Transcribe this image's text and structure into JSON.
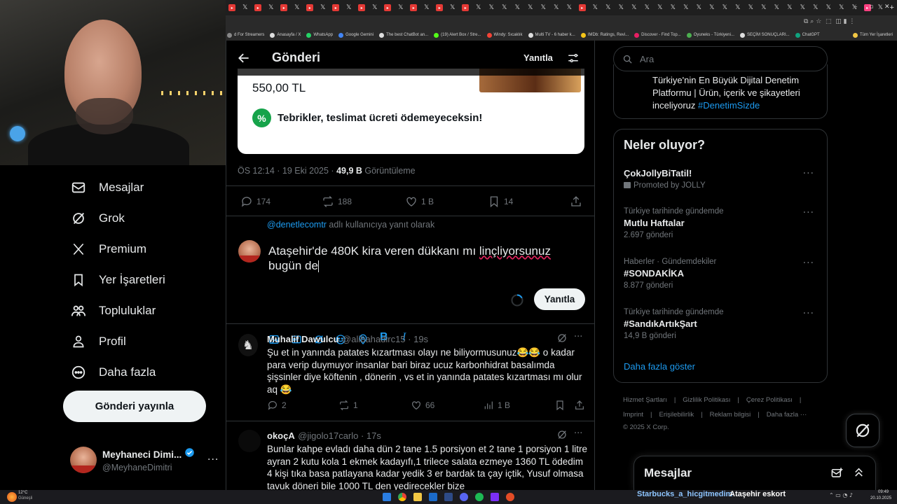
{
  "browser": {
    "bookmarks": [
      "d For Streamers",
      "Anasayfa / X",
      "WhatsApp",
      "Google Gemini",
      "The best ChatBot an...",
      "(19) Alert Box / Stre...",
      "Windy: Sıcaklık",
      "Multi TV - 6 haber k...",
      "IMDb: Ratings, Revi...",
      "Discover - Find Top...",
      "Oyuneks - Türkiyeni...",
      "SEÇİM SONUÇLARI...",
      "ChatGPT",
      "Tüm Yer İşaretleri"
    ]
  },
  "nav": {
    "items": [
      {
        "label": "Mesajlar",
        "icon": "mail-icon"
      },
      {
        "label": "Grok",
        "icon": "grok-icon"
      },
      {
        "label": "Premium",
        "icon": "x-logo-icon"
      },
      {
        "label": "Yer İşaretleri",
        "icon": "bookmark-icon"
      },
      {
        "label": "Topluluklar",
        "icon": "communities-icon"
      },
      {
        "label": "Profil",
        "icon": "profile-icon"
      },
      {
        "label": "Daha fazla",
        "icon": "more-circle-icon"
      }
    ],
    "post_button": "Gönderi yayınla",
    "profile": {
      "name": "Meyhaneci Dimi...",
      "handle": "@MeyhaneDimitri"
    }
  },
  "main": {
    "header": {
      "title": "Gönderi",
      "reply_label": "Yanıtla"
    },
    "card": {
      "price": "550,00 TL",
      "promo": "Tebrikler, teslimat ücreti ödemeyeceksin!"
    },
    "meta": {
      "time": "ÖS 12:14 · 19 Eki 2025 · ",
      "views": "49,9 B",
      "views_label": " Görüntüleme"
    },
    "actions": {
      "replies": "174",
      "reposts": "188",
      "likes": "1 B",
      "bookmarks": "14"
    },
    "reply_to": {
      "handle": "@denetlecomtr",
      "suffix": " adlı kullanıcıya yanıt olarak"
    },
    "composer": {
      "text_before": "Ataşehir'de 480K kira veren dükkanı mı ",
      "text_misspelled": "linçliyorsunuz",
      "text_after": " bugün de",
      "reply_button": "Yanıtla"
    },
    "replies": [
      {
        "name": "Muhalif Dawulcu",
        "handle": "@alibahadirc15 · 19s",
        "text": "Şu et in yanında patates kızartması olayı ne biliyormusunuz😂😂 o kadar para verip duymuyor insanlar bari biraz ucuz karbonhidrat basalımda şişsinler diye köftenin , dönerin , vs et in yanında patates kızartması mı olur aq 😂",
        "replies": "2",
        "reposts": "1",
        "likes": "66",
        "views": "1 B"
      },
      {
        "name": "okoçA",
        "handle": "@jigolo17carlo · 17s",
        "text": "Bunlar kahpe evladı daha dün 2 tane 1.5 porsiyon et 2 tane 1 porsiyon 1 litre ayran 2 kutu kola 1 ekmek kadayıfı,1 trilece salata ezmeye 1360 TL ödedim 4 kişi tıka basa patlayana kadar yedik 3 er bardak ta çay içtik, Yusuf olmasa tavuk döneri bile 1000 TL den yedirecekler bize"
      }
    ]
  },
  "right": {
    "search_placeholder": "Ara",
    "top_box_text": "Türkiye'nin En Büyük Dijital Denetim Platformu | Ürün, içerik ve şikayetleri inceliyoruz ",
    "top_box_hashtag": "#DenetimSizde",
    "trends_title": "Neler oluyor?",
    "trends": [
      {
        "context": "",
        "name": "ÇokJollyBiTatil!",
        "count": "Promoted by JOLLY"
      },
      {
        "context": "Türkiye tarihinde gündemde",
        "name": "Mutlu Haftalar",
        "count": "2.697 gönderi"
      },
      {
        "context": "Haberler · Gündemdekiler",
        "name": "#SONDAKİKA",
        "count": "8.877 gönderi"
      },
      {
        "context": "Türkiye tarihinde gündemde",
        "name": "#SandıkArtıkŞart",
        "count": "14,9 B gönderi"
      }
    ],
    "show_more": "Daha fazla göster",
    "footer_row1": [
      "Hizmet Şartları",
      "Gizlilik Politikası",
      "Çerez Politikası"
    ],
    "footer_row2": [
      "Imprint",
      "Erişilebilirlik",
      "Reklam bilgisi",
      "Daha fazla ···"
    ],
    "footer_copyright": "© 2025 X Corp.",
    "messages_drawer": "Mesajlar"
  },
  "taskbar": {
    "weather_temp": "12°C",
    "weather_label": "Güneşli",
    "ticker_user": "Starbucks_a_hicgitmedim",
    "ticker_text": "Ataşehir eskort",
    "time": "09:49",
    "date": "20.10.2025"
  },
  "colors": {
    "accent": "#1d9bf0",
    "promo_green": "#16a34a",
    "verified": "#1d9bf0"
  }
}
